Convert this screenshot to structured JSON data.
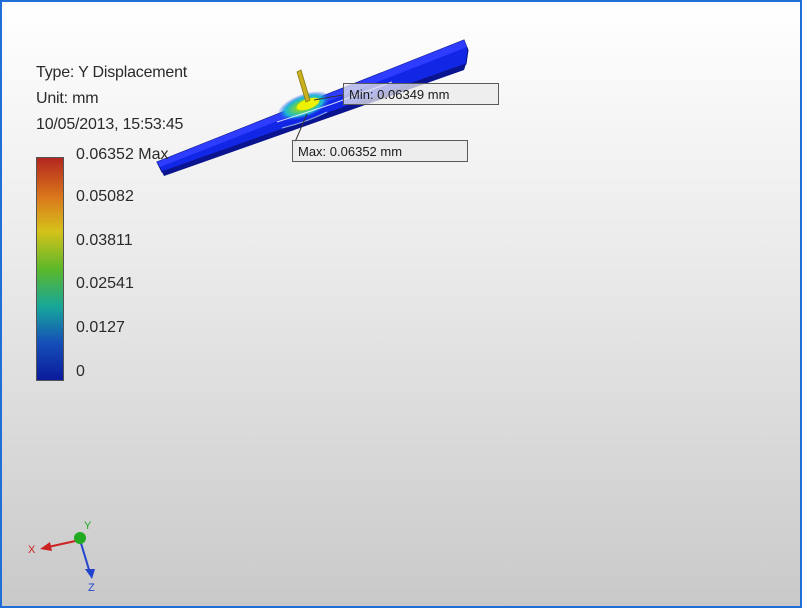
{
  "result": {
    "type_line": "Type: Y Displacement",
    "unit_line": "Unit: mm",
    "date_line": "10/05/2013, 15:53:45"
  },
  "legend": {
    "labels": [
      "0.06352 Max",
      "0.05082",
      "0.03811",
      "0.02541",
      "0.0127",
      "0"
    ],
    "colors": [
      "#b3261e",
      "#d9741c",
      "#d6c21a",
      "#5cb82a",
      "#17a79a",
      "#1650b8",
      "#0a1a9c"
    ]
  },
  "probes": {
    "min_label": "Min: 0.06349 mm",
    "max_label": "Max: 0.06352 mm"
  },
  "triad": {
    "x_label": "X",
    "y_label": "Y",
    "z_label": "Z",
    "x_color": "#cc2222",
    "y_color": "#22aa22",
    "z_color": "#2244cc"
  }
}
